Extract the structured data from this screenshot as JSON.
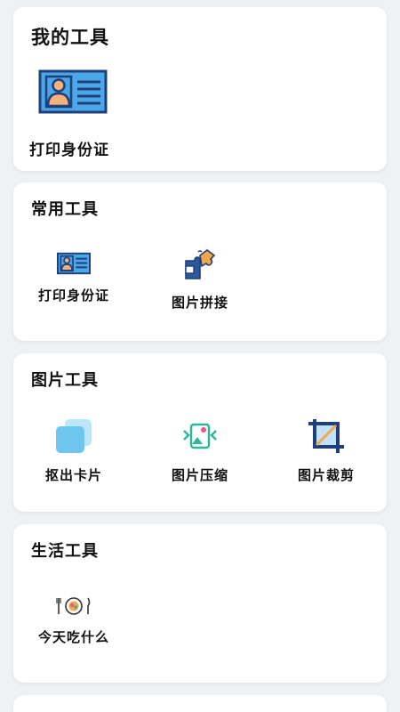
{
  "my_tools": {
    "title": "我的工具",
    "items": [
      {
        "label": "打印身份证",
        "icon": "id-card-icon"
      }
    ]
  },
  "common_tools": {
    "title": "常用工具",
    "items": [
      {
        "label": "打印身份证",
        "icon": "id-card-icon"
      },
      {
        "label": "图片拼接",
        "icon": "puzzle-icon"
      }
    ]
  },
  "image_tools": {
    "title": "图片工具",
    "items": [
      {
        "label": "抠出卡片",
        "icon": "cards-icon"
      },
      {
        "label": "图片压缩",
        "icon": "image-compress-icon"
      },
      {
        "label": "图片裁剪",
        "icon": "crop-icon"
      }
    ]
  },
  "life_tools": {
    "title": "生活工具",
    "items": [
      {
        "label": "今天吃什么",
        "icon": "plate-cutlery-icon"
      }
    ]
  },
  "colors": {
    "page_background": "#eef2f5",
    "card_background": "#ffffff",
    "id_card_blue": "#4aa8e8",
    "id_card_border": "#1f3f7a",
    "accent_orange": "#f4a64a",
    "card_light_blue": "#6cc6ee",
    "compress_teal": "#2fb59b",
    "compress_pink": "#e8558b"
  }
}
